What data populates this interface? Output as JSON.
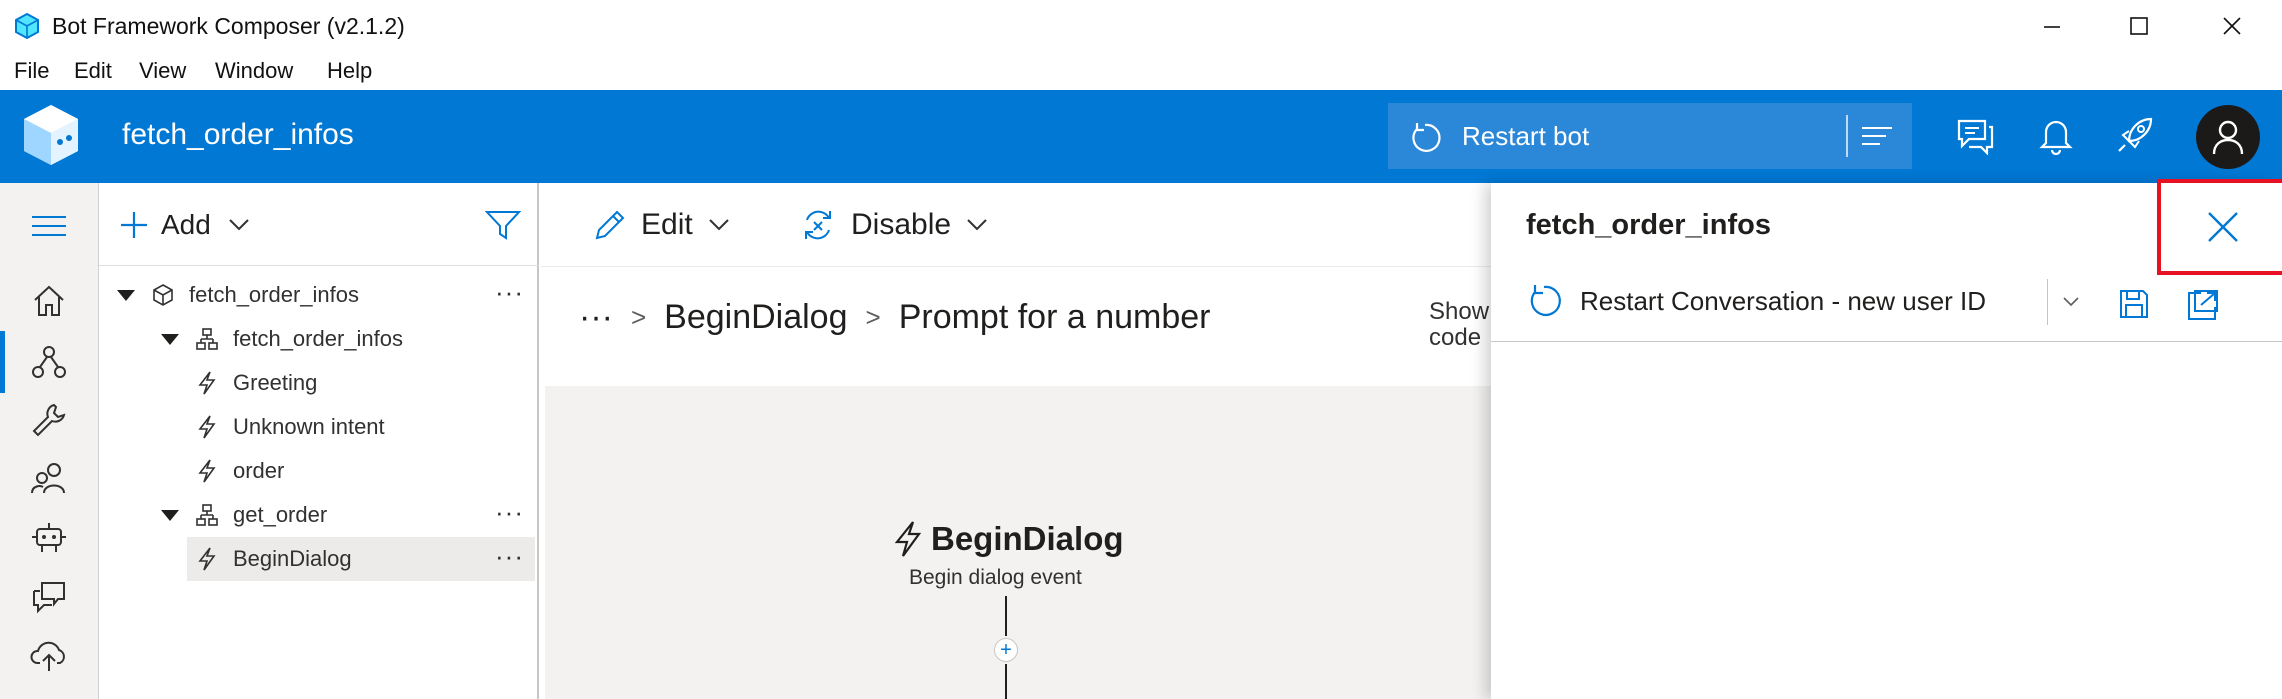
{
  "window": {
    "title": "Bot Framework Composer (v2.1.2)",
    "menu": [
      "File",
      "Edit",
      "View",
      "Window",
      "Help"
    ]
  },
  "header": {
    "bot_name": "fetch_order_infos",
    "restart_label": "Restart bot",
    "icons": [
      "chat-icon",
      "bell-icon",
      "rocket-icon",
      "user-avatar-icon"
    ]
  },
  "nav": {
    "items": [
      "home-icon",
      "design-icon",
      "wrench-icon",
      "users-icon",
      "bot-icon",
      "chat-bubbles-icon",
      "cloud-upload-icon"
    ],
    "active": "design-icon"
  },
  "tree": {
    "add_label": "Add",
    "rows": [
      {
        "label": "fetch_order_infos",
        "type": "bot"
      },
      {
        "label": "fetch_order_infos",
        "type": "dialog"
      },
      {
        "label": "Greeting",
        "type": "trigger"
      },
      {
        "label": "Unknown intent",
        "type": "trigger"
      },
      {
        "label": "order",
        "type": "trigger"
      },
      {
        "label": "get_order",
        "type": "dialog"
      },
      {
        "label": "BeginDialog",
        "type": "trigger",
        "selected": true
      }
    ]
  },
  "toolbar": {
    "edit_label": "Edit",
    "disable_label": "Disable"
  },
  "breadcrumb": {
    "ellipsis": "···",
    "items": [
      "BeginDialog",
      "Prompt for a number"
    ]
  },
  "show_code": {
    "line1": "Show",
    "line2": "code"
  },
  "flow": {
    "event_title": "BeginDialog",
    "event_subtitle": "Begin dialog event",
    "add_symbol": "+"
  },
  "chat_panel": {
    "title": "fetch_order_infos",
    "restart_label": "Restart Conversation - new user ID"
  },
  "colors": {
    "accent": "#0078d4",
    "header_bg": "#0078d4",
    "highlight_border": "#e81123"
  }
}
